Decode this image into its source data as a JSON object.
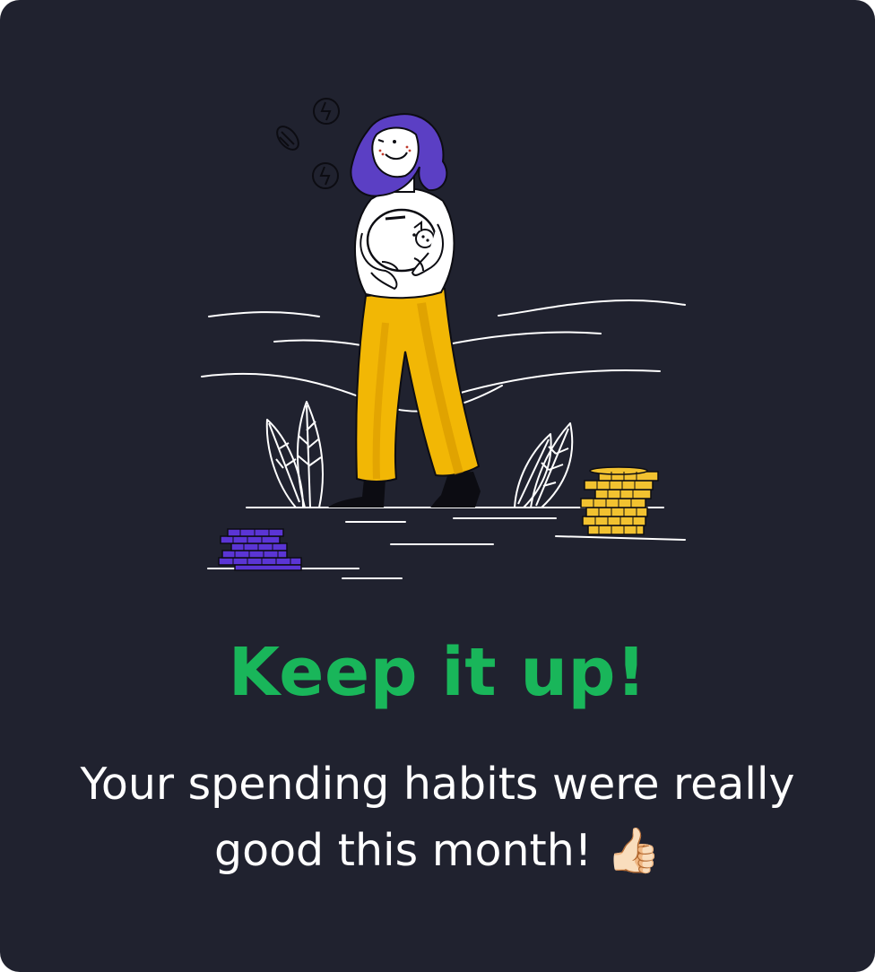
{
  "card": {
    "headline": "Keep it up!",
    "message": "Your spending habits were really good this month! 👍🏻"
  },
  "illustration": {
    "subject": "woman-holding-piggy-bank",
    "icons": [
      "coin-icon",
      "coin-stack-icon",
      "leaf-icon",
      "piggy-bank-icon"
    ]
  },
  "colors": {
    "background": "#20222f",
    "headline": "#19b65a",
    "message": "#ffffff",
    "hair": "#5b3fc4",
    "pants": "#f2b705",
    "gold_coins": "#f2c230",
    "purple_coins": "#5b35d5"
  }
}
